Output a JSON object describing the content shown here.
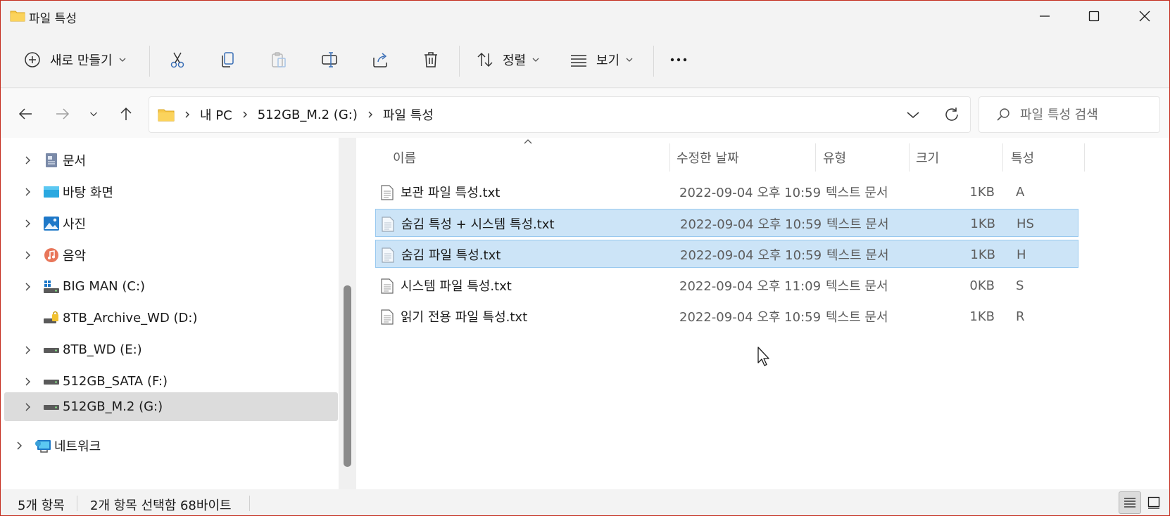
{
  "window": {
    "title": "파일 특성"
  },
  "toolbar": {
    "new_label": "새로 만들기",
    "sort_label": "정렬",
    "view_label": "보기"
  },
  "address": {
    "crumbs": [
      "내 PC",
      "512GB_M.2 (G:)",
      "파일 특성"
    ],
    "search_placeholder": "파일 특성 검색"
  },
  "nav": {
    "items": [
      {
        "label": "문서",
        "icon": "documents-icon"
      },
      {
        "label": "바탕 화면",
        "icon": "desktop-icon"
      },
      {
        "label": "사진",
        "icon": "pictures-icon"
      },
      {
        "label": "음악",
        "icon": "music-icon"
      },
      {
        "label": "BIG MAN (C:)",
        "icon": "system-drive-icon"
      },
      {
        "label": "8TB_Archive_WD (D:)",
        "icon": "locked-drive-icon"
      },
      {
        "label": "8TB_WD (E:)",
        "icon": "drive-icon"
      },
      {
        "label": "512GB_SATA (F:)",
        "icon": "drive-icon"
      },
      {
        "label": "512GB_M.2 (G:)",
        "icon": "drive-icon"
      },
      {
        "label": "네트워크",
        "icon": "network-icon"
      }
    ]
  },
  "columns": {
    "name": "이름",
    "date": "수정한 날짜",
    "type": "유형",
    "size": "크기",
    "attr": "특성"
  },
  "files": [
    {
      "name": "보관 파일 특성.txt",
      "date": "2022-09-04 오후 10:59",
      "type": "텍스트 문서",
      "size": "1KB",
      "attr": "A",
      "selected": false
    },
    {
      "name": "숨김 특성 + 시스템 특성.txt",
      "date": "2022-09-04 오후 10:59",
      "type": "텍스트 문서",
      "size": "1KB",
      "attr": "HS",
      "selected": true
    },
    {
      "name": "숨김 파일 특성.txt",
      "date": "2022-09-04 오후 10:59",
      "type": "텍스트 문서",
      "size": "1KB",
      "attr": "H",
      "selected": true
    },
    {
      "name": "시스템 파일 특성.txt",
      "date": "2022-09-04 오후 11:09",
      "type": "텍스트 문서",
      "size": "0KB",
      "attr": "S",
      "selected": false
    },
    {
      "name": "읽기 전용 파일 특성.txt",
      "date": "2022-09-04 오후 10:59",
      "type": "텍스트 문서",
      "size": "1KB",
      "attr": "R",
      "selected": false
    }
  ],
  "status": {
    "count": "5개 항목",
    "selection": "2개 항목 선택함 68바이트"
  },
  "colors": {
    "selection": "#cce4f7",
    "selection_border": "#99c9ef",
    "folder": "#f8c94a",
    "window_border": "#c42b1c"
  }
}
